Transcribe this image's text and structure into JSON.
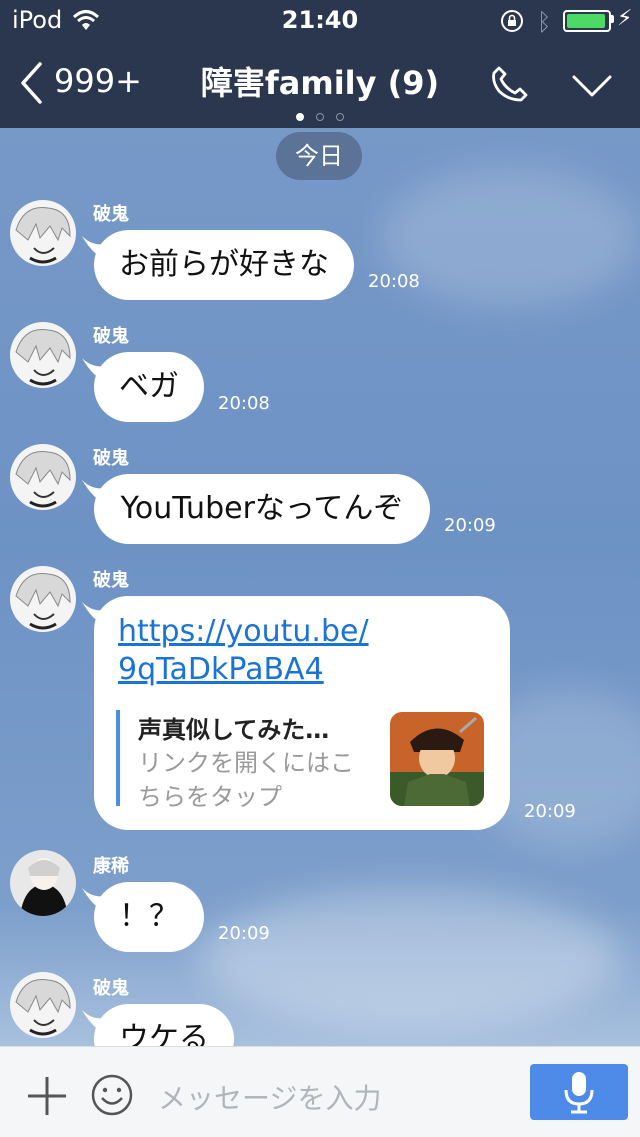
{
  "status": {
    "carrier": "iPod",
    "time": "21:40",
    "battery_level": 0.95
  },
  "header": {
    "back_count": "999+",
    "title": "障害family (9)",
    "page_index": 0,
    "page_count": 3,
    "icons": [
      "chevron-left-icon",
      "phone-icon",
      "chevron-down-icon"
    ]
  },
  "chat": {
    "date_divider": "今日",
    "messages": [
      {
        "sender": "破鬼",
        "text": "お前らが好きな",
        "time": "20:08"
      },
      {
        "sender": "破鬼",
        "text": "ベガ",
        "time": "20:08"
      },
      {
        "sender": "破鬼",
        "text": "YouTuberなってんぞ",
        "time": "20:09"
      },
      {
        "sender": "破鬼",
        "link_line1": "https://youtu.be/",
        "link_line2": "9qTaDkPaBA4",
        "preview_title": "声真似してみた…",
        "preview_sub1": "リンクを開くにはこ",
        "preview_sub2": "ちらをタップ",
        "time": "20:09"
      },
      {
        "sender": "康稀",
        "text": "！？",
        "time": "20:09"
      },
      {
        "sender": "破鬼",
        "text": "ウケる",
        "time": ""
      }
    ]
  },
  "composer": {
    "placeholder": "メッセージを入力"
  },
  "colors": {
    "header_bg": "#2b374f",
    "accent": "#4e8ae8",
    "link": "#1a73d6",
    "chat_bg": "#6f95c6"
  }
}
